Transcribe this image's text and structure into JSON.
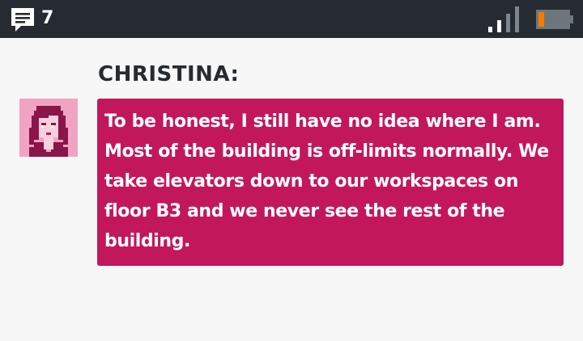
{
  "status_bar": {
    "message_icon": "chat-bubble-icon",
    "message_count": "7",
    "signal_icon": "signal-strength-icon",
    "battery_icon": "battery-low-icon",
    "colors": {
      "bar_background": "#252b30",
      "battery_level": "#f57c00"
    }
  },
  "dialogue": {
    "speaker": "CHRISTINA:",
    "avatar_icon": "christina-portrait-icon",
    "message": "To be honest, I still have no idea where I am. Most of the building is off-limits normally. We take elevators down to our workspaces on floor B3 and we never see the rest of the building.",
    "colors": {
      "bubble": "#c2185b",
      "avatar_background": "#f2a3c4",
      "speaker_text": "#252b30"
    }
  }
}
